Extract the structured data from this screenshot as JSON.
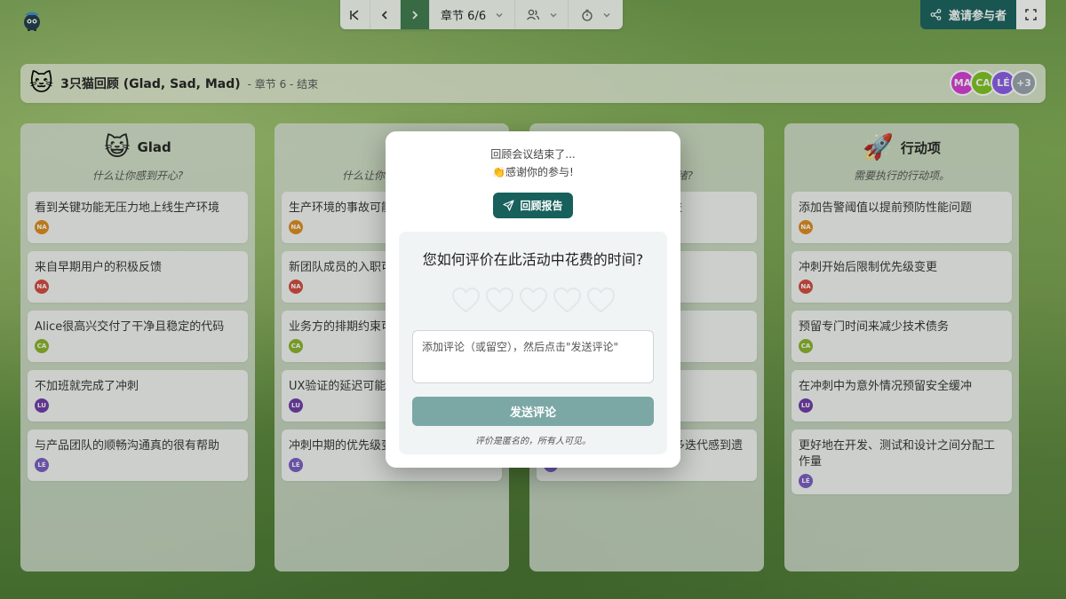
{
  "nav": {
    "chapter_label": "章节 6/6",
    "invite_label": "邀请参与者"
  },
  "header": {
    "title": "3只猫回顾 (Glad, Sad, Mad)",
    "subtitle": "- 章节 6 - 结束",
    "avatars": [
      {
        "initials": "MA",
        "color": "#d63bd6"
      },
      {
        "initials": "CA",
        "color": "#7ec41f"
      },
      {
        "initials": "LÉ",
        "color": "#8a5be8"
      },
      {
        "initials": "+3",
        "color": "#9aa3ad"
      }
    ]
  },
  "columns": [
    {
      "title": "Glad",
      "subtitle": "什么让你感到开心?",
      "cards": [
        {
          "text": "看到关键功能无压力地上线生产环境",
          "author": "NA",
          "color": "#e08a1e"
        },
        {
          "text": "来自早期用户的积极反馈",
          "author": "NA",
          "color": "#d4493f"
        },
        {
          "text": "Alice很高兴交付了干净且稳定的代码",
          "author": "CA",
          "color": "#8ab22a"
        },
        {
          "text": "不加班就完成了冲刺",
          "author": "LU",
          "color": "#6e3aa8"
        },
        {
          "text": "与产品团队的顺畅沟通真的很有帮助",
          "author": "LÉ",
          "color": "#7b5cc4"
        }
      ]
    },
    {
      "title": "",
      "subtitle": "什么让你",
      "cards": [
        {
          "text": "生产环境的事故可能标的注意力",
          "author": "NA",
          "color": "#e08a1e"
        },
        {
          "text": "新团队成员的入职可",
          "author": "NA",
          "color": "#d4493f"
        },
        {
          "text": "业务方的排期约束可",
          "author": "CA",
          "color": "#8ab22a"
        },
        {
          "text": "UX验证的延迟可能",
          "author": "LU",
          "color": "#6e3aa8"
        },
        {
          "text": "冲刺中期的优先级变",
          "author": "LÉ",
          "color": "#7b5cc4"
        }
      ]
    },
    {
      "title": "",
      "subtitle": "绪?",
      "cards": [
        {
          "text": "技",
          "author": "",
          "color": "#e08a1e"
        },
        {
          "text": "",
          "author": "",
          "color": "#d4493f"
        },
        {
          "text": "",
          "author": "",
          "color": "#8ab22a"
        },
        {
          "text": "",
          "author": "",
          "color": "#6e3aa8"
        },
        {
          "text": "多迭代感到遗",
          "author": "LÉ",
          "color": "#7b5cc4"
        }
      ]
    },
    {
      "title": "行动项",
      "subtitle": "需要执行的行动项。",
      "cards": [
        {
          "text": "添加告警阈值以提前预防性能问题",
          "author": "NA",
          "color": "#e08a1e"
        },
        {
          "text": "冲刺开始后限制优先级变更",
          "author": "NA",
          "color": "#d4493f"
        },
        {
          "text": "预留专门时间来减少技术债务",
          "author": "CA",
          "color": "#8ab22a"
        },
        {
          "text": "在冲刺中为意外情况预留安全缓冲",
          "author": "LU",
          "color": "#6e3aa8"
        },
        {
          "text": "更好地在开发、测试和设计之间分配工作量",
          "author": "LÉ",
          "color": "#7b5cc4"
        }
      ]
    }
  ],
  "modal": {
    "line1": "回顾会议结束了...",
    "line2": "👏感谢你的参与!",
    "report_button": "回顾报告",
    "question": "您如何评价在此活动中花费的时间?",
    "rating": 0,
    "rating_max": 5,
    "comment_placeholder": "添加评论（或留空），然后点击\"发送评论\"",
    "send_button": "发送评论",
    "anonymous_note": "评价是匿名的，所有人可见。"
  }
}
